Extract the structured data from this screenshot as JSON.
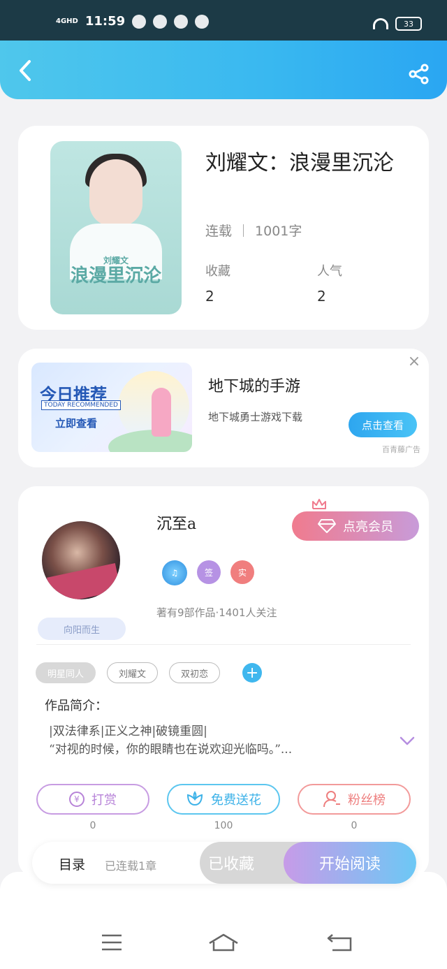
{
  "status_bar": {
    "network": "4GHD",
    "time": "11:59",
    "battery": "33"
  },
  "book": {
    "title": "刘耀文：浪漫里沉沦",
    "status": "连载",
    "word_count": "1001字",
    "favorites_label": "收藏",
    "favorites_value": "2",
    "popularity_label": "人气",
    "popularity_value": "2",
    "cover_text_small": "刘耀文",
    "cover_text_large": "浪漫里沉沦"
  },
  "ad": {
    "banner_title": "今日推荐",
    "banner_sub": "TODAY RECOMMENDED",
    "banner_cta": "立即查看",
    "title": "地下城的手游",
    "description": "地下城勇士游戏下载",
    "button": "点击查看",
    "source": "百青藤广告",
    "close": "×"
  },
  "author": {
    "name": "沉至a",
    "vip_button": "点亮会员",
    "tag": "向阳而生",
    "badge_music": "♫",
    "badge_sign": "签",
    "badge_real": "实",
    "stats": "著有9部作品·1401人关注",
    "tags": [
      "明星同人",
      "刘耀文",
      "双初恋"
    ],
    "add_tag": "+",
    "intro_label": "作品简介：",
    "intro_line1": "|双法律系|正义之神|破镜重圆|",
    "intro_line2": "“对视的时候，你的眼睛也在说欢迎光临吗。”..."
  },
  "actions": {
    "reward_label": "打赏",
    "reward_count": "0",
    "reward_symbol": "¥",
    "flower_label": "免费送花",
    "flower_count": "100",
    "fans_label": "粉丝榜",
    "fans_count": "0"
  },
  "bottom": {
    "toc_label": "目录",
    "toc_count": "已连载1章",
    "favorited": "已收藏",
    "start_reading": "开始阅读"
  },
  "colors": {
    "header": "#39b8f0",
    "accent_purple": "#c79be8",
    "accent_blue": "#3fb7ee"
  }
}
